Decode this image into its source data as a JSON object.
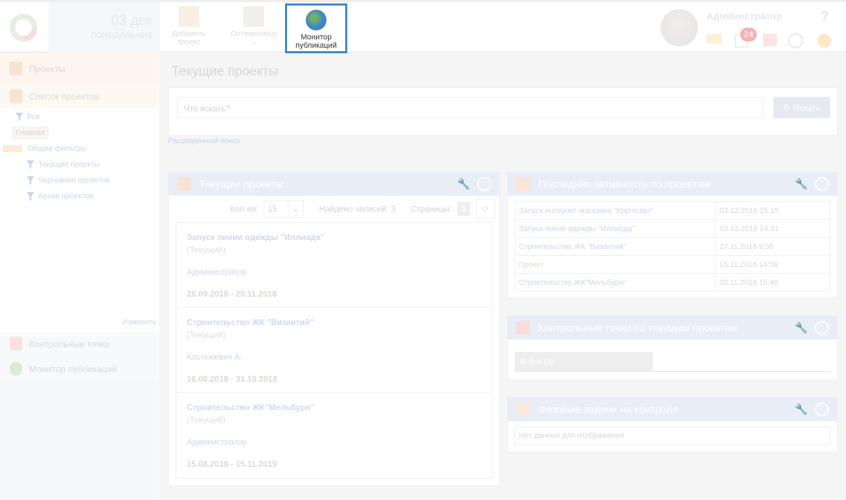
{
  "header": {
    "date_day": "03 дек",
    "date_weekday": "понедельник",
    "toolbar": [
      {
        "label": "Добавить проект"
      },
      {
        "label": "Оптимизатор"
      },
      {
        "label": "Монитор публикаций"
      }
    ],
    "user_name": "Администратор",
    "task_badge": "24",
    "help": "?"
  },
  "sidebar": {
    "section": "Проекты",
    "list": "Список проектов",
    "tree": [
      "Все",
      "Главная",
      "Общие фильтры",
      "Текущие проекты",
      "Черновики проектов",
      "Архив проектов"
    ],
    "edit_link": "Изменить",
    "items": [
      "Контрольные точки",
      "Монитор публикаций"
    ]
  },
  "main": {
    "title": "Текущие проекты",
    "search_placeholder": "Что искать?",
    "search_button": "Искать",
    "advanced": "Расширенный поиск",
    "projects_panel": {
      "title": "Текущие проекты",
      "count_label": "Кол-во:",
      "count_value": "15",
      "found": "Найдено записей: 3",
      "pages_label": "Страницы:",
      "page": "1",
      "cards": [
        {
          "name": "Запуск линии одежды \"Иллиада\"",
          "status": "(Текущий)",
          "owner": "Администратор",
          "dates": "28.09.2018 - 20.11.2018"
        },
        {
          "name": "Строительство ЖК \"Византий\"",
          "status": "(Текущий)",
          "owner": "Костюкевич А.",
          "dates": "16.08.2018 - 31.10.2018"
        },
        {
          "name": "Строительство ЖК\"Мельбурн\"",
          "status": "(Текущий)",
          "owner": "Администратор",
          "dates": "15.08.2018 - 15.11.2019"
        }
      ]
    },
    "activity_panel": {
      "title": "Последняя активность по проектам",
      "rows": [
        {
          "name": "Запуск интернет-магазина \"Кругосвет\"",
          "date": "03.12.2018 15:15"
        },
        {
          "name": "Запуск линии одежды \"Иллиада\"",
          "date": "03.12.2018 14:31"
        },
        {
          "name": "Строительство ЖК \"Византий\"",
          "date": "27.11.2018 9:55"
        },
        {
          "name": "Проект",
          "date": "15.11.2018 14:59"
        },
        {
          "name": "Строительство ЖК\"Мельбурн\"",
          "date": "02.11.2018 15:46"
        }
      ]
    },
    "checkpoints_panel": {
      "title": "Контрольные точки по текущим проектам",
      "all": "Все (0)"
    },
    "phase_panel": {
      "title": "Фазовые задачи на контроле",
      "empty": "Нет данных для отображения"
    }
  }
}
